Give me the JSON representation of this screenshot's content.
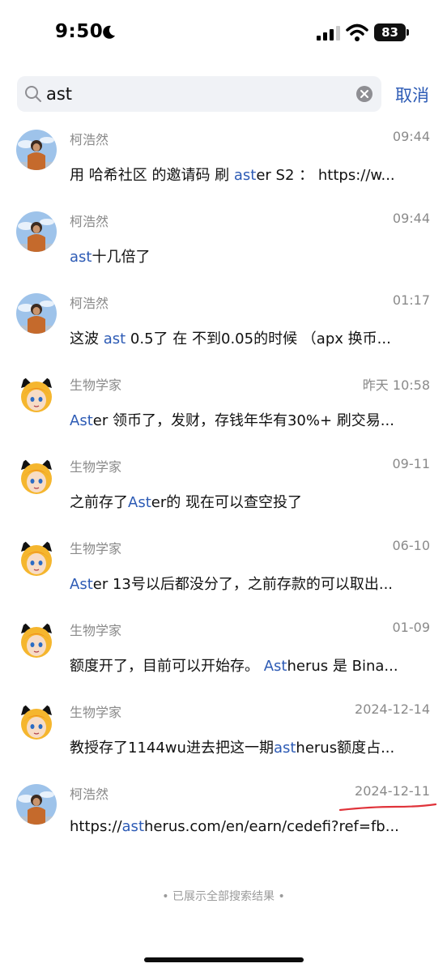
{
  "status_bar": {
    "time": "9:50",
    "battery": "83"
  },
  "search": {
    "query": "ast",
    "cancel_label": "取消"
  },
  "colors": {
    "highlight": "#2d5bb5",
    "meta_text": "#8a8a8a",
    "annotation": "#e0333a"
  },
  "results": [
    {
      "avatar": "person-photo-avatar",
      "sender": "柯浩然",
      "time": "09:44",
      "parts": [
        {
          "text": "用 哈希社区 的邀请码 刷 ",
          "hl": false
        },
        {
          "text": "ast",
          "hl": true
        },
        {
          "text": "er S2 ： https://w...",
          "hl": false
        }
      ]
    },
    {
      "avatar": "person-photo-avatar",
      "sender": "柯浩然",
      "time": "09:44",
      "parts": [
        {
          "text": "ast",
          "hl": true
        },
        {
          "text": "十几倍了",
          "hl": false
        }
      ]
    },
    {
      "avatar": "person-photo-avatar",
      "sender": "柯浩然",
      "time": "01:17",
      "parts": [
        {
          "text": "这波 ",
          "hl": false
        },
        {
          "text": "ast",
          "hl": true
        },
        {
          "text": " 0.5了 在 不到0.05的时候 （apx 换币...",
          "hl": false
        }
      ]
    },
    {
      "avatar": "anime-cat-avatar",
      "sender": "生物学家",
      "time": "昨天 10:58",
      "parts": [
        {
          "text": "Ast",
          "hl": true
        },
        {
          "text": "er 领币了，发财，存钱年华有30%+ 刷交易...",
          "hl": false
        }
      ]
    },
    {
      "avatar": "anime-cat-avatar",
      "sender": "生物学家",
      "time": "09-11",
      "parts": [
        {
          "text": "之前存了",
          "hl": false
        },
        {
          "text": "Ast",
          "hl": true
        },
        {
          "text": "er的 现在可以查空投了",
          "hl": false
        }
      ]
    },
    {
      "avatar": "anime-cat-avatar",
      "sender": "生物学家",
      "time": "06-10",
      "parts": [
        {
          "text": "Ast",
          "hl": true
        },
        {
          "text": "er 13号以后都没分了，之前存款的可以取出...",
          "hl": false
        }
      ]
    },
    {
      "avatar": "anime-cat-avatar",
      "sender": "生物学家",
      "time": "01-09",
      "parts": [
        {
          "text": "额度开了，目前可以开始存。 ",
          "hl": false
        },
        {
          "text": "Ast",
          "hl": true
        },
        {
          "text": "herus 是 Bina...",
          "hl": false
        }
      ]
    },
    {
      "avatar": "anime-cat-avatar",
      "sender": "生物学家",
      "time": "2024-12-14",
      "parts": [
        {
          "text": "教授存了1144wu进去把这一期",
          "hl": false
        },
        {
          "text": "ast",
          "hl": true
        },
        {
          "text": "herus额度占...",
          "hl": false
        }
      ]
    },
    {
      "avatar": "person-photo-avatar",
      "sender": "柯浩然",
      "time": "2024-12-11",
      "parts": [
        {
          "text": "https://",
          "hl": false
        },
        {
          "text": "ast",
          "hl": true
        },
        {
          "text": "herus.com/en/earn/cedefi?ref=fb...",
          "hl": false
        }
      ]
    }
  ],
  "footer": "• 已展示全部搜索结果 •"
}
